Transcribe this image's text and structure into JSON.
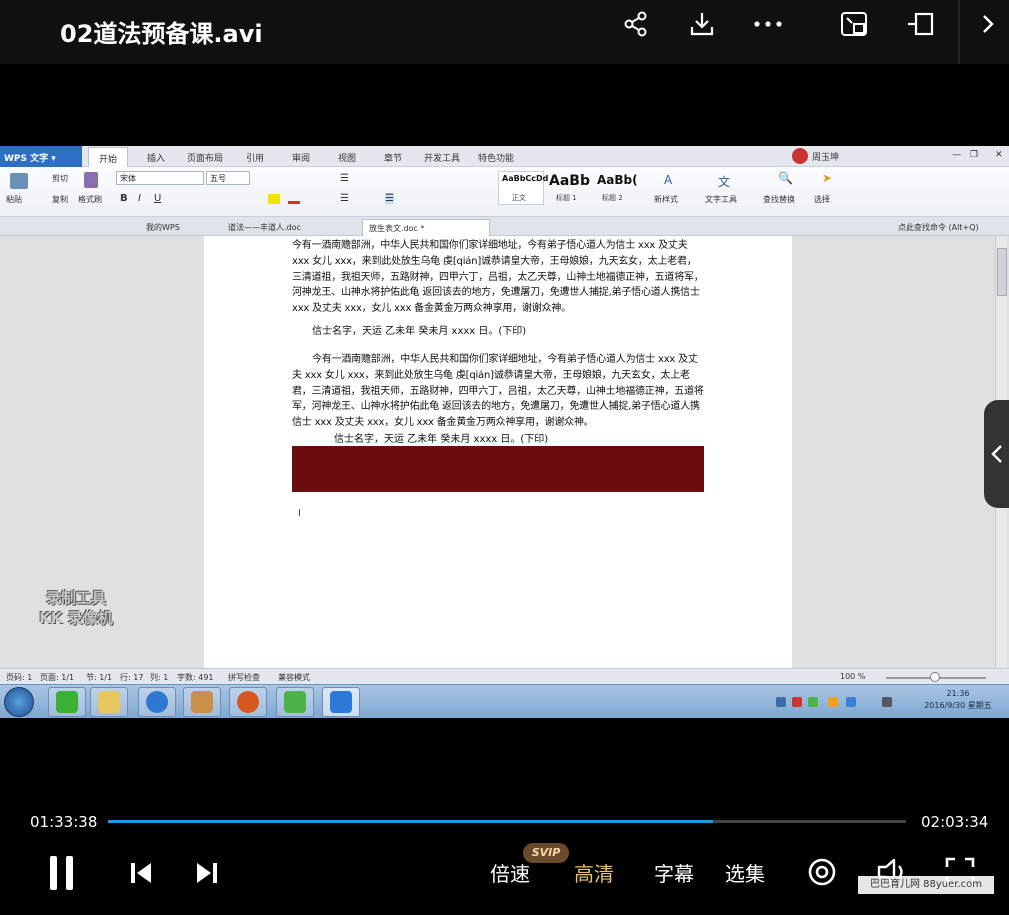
{
  "player": {
    "title": "02道法预备课.avi",
    "current_time": "01:33:38",
    "total_time": "02:03:34",
    "progress": 0.758,
    "accent_color": "#1c9be6",
    "icons": [
      "share-icon",
      "download-icon",
      "more-icon",
      "picture-in-picture-icon",
      "cast-icon",
      "chevron-right-icon"
    ],
    "controls": {
      "speed_label": "倍速",
      "svip_badge": "SVIP",
      "quality_label": "高清",
      "subtitle_label": "字幕",
      "episodes_label": "选集"
    },
    "site_watermark": "巴巴育儿网 88yuer.com"
  },
  "wps": {
    "app_label": "WPS 文字",
    "menu_tabs": [
      "开始",
      "插入",
      "页面布局",
      "引用",
      "审阅",
      "视图",
      "章节",
      "开发工具",
      "特色功能"
    ],
    "user_name": "周玉坤",
    "ribbon": {
      "paste": "粘贴",
      "cut": "剪切",
      "copy": "复制",
      "format_painter": "格式刷",
      "font_name": "宋体",
      "font_size": "五号",
      "style_normal_sample": "AaBbCcDd",
      "style_normal": "正文",
      "style_h1_sample": "AaBb",
      "style_h1": "标题 1",
      "style_h2_sample": "AaBb(",
      "style_h2": "标题 2",
      "new_style": "新样式",
      "text_tools": "文字工具",
      "find_replace": "查找替换",
      "select": "选择"
    },
    "doc_tabs": [
      "我的WPS",
      "道法——丰道人.doc",
      "放生表文.doc *"
    ],
    "search_hint": "点此查找命令 (Alt+Q)",
    "document": {
      "para1": "今有一酒南赡部洲，中华人民共和国你们家详细地址，今有弟子悟心道人为信士 xxx 及丈夫 xxx 女儿 xxx，来到此处放生乌龟 虔[qián]诚恭请皇大帝，王母娘娘，九天玄女，太上老君，三清道祖，我祖天师，五路财神，四甲六丁，吕祖，太乙天尊，山神土地福德正神，五道将军，河神龙王、山神水将护佑此龟 返回该去的地方，免遭屠刀，免遭世人捕捉,弟子悟心道人携信士 xxx 及丈夫 xxx，女儿 xxx 备金黄金万两众神享用，谢谢众神。",
      "sig1": "信士名字，天运  乙未年  癸未月 xxxx 日。(下印)",
      "para2": "今有一酒南赡部洲，中华人民共和国你们家详细地址，今有弟子悟心道人为信士 xxx 及丈夫 xxx 女儿 xxx，来到此处放生乌龟 虔[qián]诚恭请皇大帝，王母娘娘，九天玄女，太上老君，三清道祖，我祖天师，五路财神，四甲六丁，吕祖，太乙天尊，山神土地福德正神，五道将军，河神龙王、山神水将护佑此龟 返回该去的地方，免遭屠刀，免遭世人捕捉,弟子悟心道人携信士 xxx 及丈夫 xxx，女儿 xxx 备金黄金万两众神享用，谢谢众神。",
      "sig2": "信士名字，天运  乙未年  癸未月 xxxx 日。(下印)"
    },
    "recorder_watermark": [
      "录制工具",
      "KK 录像机"
    ],
    "status": {
      "page_num": "页码: 1",
      "pages": "页面: 1/1",
      "section": "节: 1/1",
      "row": "行: 17",
      "col": "列: 1",
      "words": "字数: 491",
      "spell": "拼写检查",
      "compat": "兼容模式",
      "zoom": "100 %"
    },
    "clock": {
      "time": "21:36",
      "date": "2016/9/30 星期五"
    }
  }
}
